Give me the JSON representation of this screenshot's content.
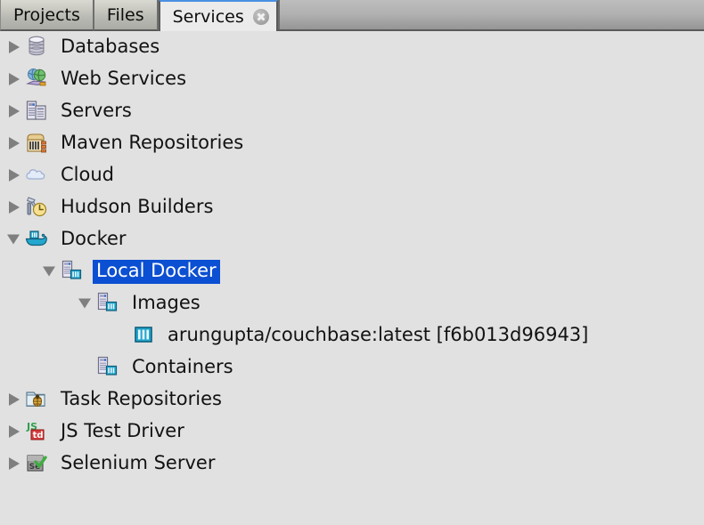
{
  "window": {
    "background_color": "#e1e1e1"
  },
  "tabs": {
    "items": [
      {
        "label": "Projects",
        "active": false,
        "closable": false,
        "name": "tab-projects"
      },
      {
        "label": "Files",
        "active": false,
        "closable": false,
        "name": "tab-files"
      },
      {
        "label": "Services",
        "active": true,
        "closable": true,
        "name": "tab-services"
      }
    ],
    "active_tab": "Services",
    "close_icon": "close-icon",
    "active_top_border_color": "#4a90e2"
  },
  "tree": {
    "selection_color": "#0b4fd2",
    "selected_item": "Local Docker",
    "nodes": [
      {
        "label": "Databases",
        "icon": "database-icon",
        "state": "collapsed",
        "depth": 0,
        "selected": false
      },
      {
        "label": "Web Services",
        "icon": "web-services-icon",
        "state": "collapsed",
        "depth": 0,
        "selected": false
      },
      {
        "label": "Servers",
        "icon": "server-icon",
        "state": "collapsed",
        "depth": 0,
        "selected": false
      },
      {
        "label": "Maven Repositories",
        "icon": "maven-icon",
        "state": "collapsed",
        "depth": 0,
        "selected": false
      },
      {
        "label": "Cloud",
        "icon": "cloud-icon",
        "state": "collapsed",
        "depth": 0,
        "selected": false
      },
      {
        "label": "Hudson Builders",
        "icon": "hudson-icon",
        "state": "collapsed",
        "depth": 0,
        "selected": false
      },
      {
        "label": "Docker",
        "icon": "docker-whale-icon",
        "state": "expanded",
        "depth": 0,
        "selected": false
      },
      {
        "label": "Local Docker",
        "icon": "docker-host-icon",
        "state": "expanded",
        "depth": 1,
        "selected": true
      },
      {
        "label": "Images",
        "icon": "docker-host-icon",
        "state": "expanded",
        "depth": 2,
        "selected": false
      },
      {
        "label": "arungupta/couchbase:latest [f6b013d96943]",
        "icon": "docker-image-icon",
        "state": "leaf",
        "depth": 3,
        "selected": false
      },
      {
        "label": "Containers",
        "icon": "docker-host-icon",
        "state": "leaf",
        "depth": 2,
        "selected": false
      },
      {
        "label": "Task Repositories",
        "icon": "task-repositories-icon",
        "state": "collapsed",
        "depth": 0,
        "selected": false
      },
      {
        "label": "JS Test Driver",
        "icon": "js-test-driver-icon",
        "state": "collapsed",
        "depth": 0,
        "selected": false
      },
      {
        "label": "Selenium Server",
        "icon": "selenium-server-icon",
        "state": "collapsed",
        "depth": 0,
        "selected": false
      }
    ]
  }
}
